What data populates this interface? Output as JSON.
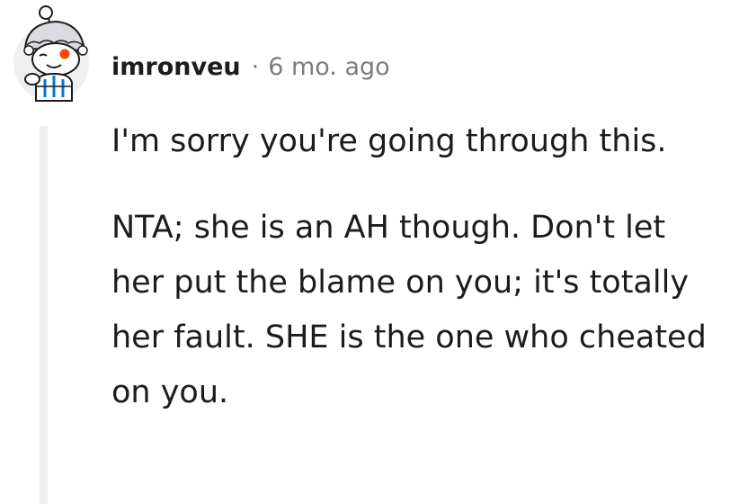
{
  "comment": {
    "username": "imronveu",
    "separator": "·",
    "timestamp": "6 mo. ago",
    "avatar_icon": "reddit-snoo-winter-hat-avatar-icon",
    "paragraphs": [
      "I'm sorry you're going through this.",
      "NTA; she is an AH though. Don't let her put the blame on you; it's totally her fault. SHE is the one who cheated on you."
    ]
  },
  "colors": {
    "text": "#1c1c1c",
    "meta": "#7c7c7c",
    "thread_line": "#edeff1",
    "avatar_bg": "#edeff1",
    "snoo_eye": "#ff4500",
    "snoo_hat": "#d9dbe0"
  }
}
